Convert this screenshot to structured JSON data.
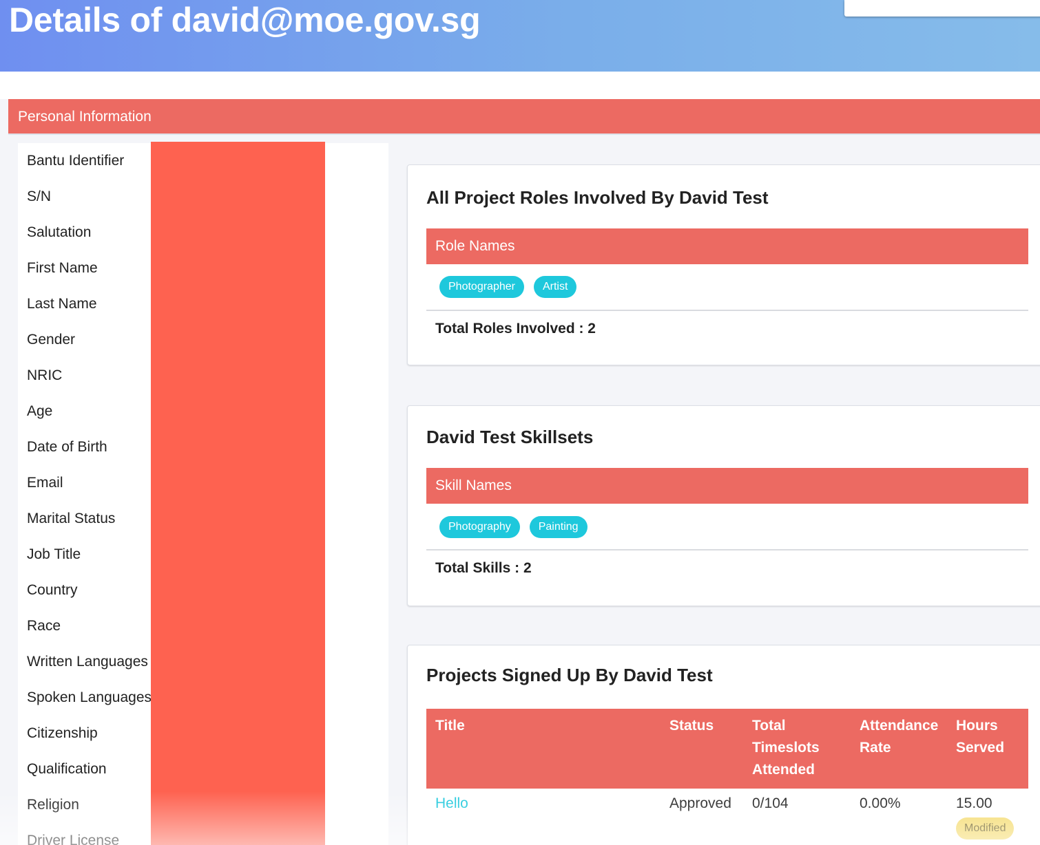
{
  "header": {
    "title": "Details of david@moe.gov.sg"
  },
  "personal_info": {
    "section_title": "Personal Information",
    "labels": [
      "Bantu Identifier",
      "S/N",
      "Salutation",
      "First Name",
      "Last Name",
      "Gender",
      "NRIC",
      "Age",
      "Date of Birth",
      "Email",
      "Marital Status",
      "Job Title",
      "Country",
      "Race",
      "Written Languages",
      "Spoken Languages",
      "Citizenship",
      "Qualification",
      "Religion",
      "Driver License"
    ]
  },
  "roles_card": {
    "title": "All Project Roles Involved By David Test",
    "table_header": "Role Names",
    "tags": [
      "Photographer",
      "Artist"
    ],
    "total": "Total Roles Involved : 2"
  },
  "skills_card": {
    "title": "David Test Skillsets",
    "table_header": "Skill Names",
    "tags": [
      "Photography",
      "Painting"
    ],
    "total": "Total Skills : 2"
  },
  "projects_card": {
    "title": "Projects Signed Up By David Test",
    "columns": {
      "title": "Title",
      "status": "Status",
      "timeslots_1": "Total",
      "timeslots_2": "Timeslots",
      "timeslots_3": "Attended",
      "attendance_1": "Attendance",
      "attendance_2": "Rate",
      "hours_1": "Hours",
      "hours_2": "Served"
    },
    "rows": [
      {
        "title": "Hello",
        "status": "Approved",
        "timeslots": "0/104",
        "attendance_rate": "0.00%",
        "hours_served": "15.00",
        "badge": "Modified"
      }
    ]
  },
  "colors": {
    "header_gradient_start": "#6f8ff0",
    "header_gradient_end": "#86bcea",
    "section_bar": "#ec6a62",
    "redaction": "#fe6250",
    "tag": "#1ec8dc",
    "badge": "#f4da6a",
    "link": "#1ec8dc"
  }
}
